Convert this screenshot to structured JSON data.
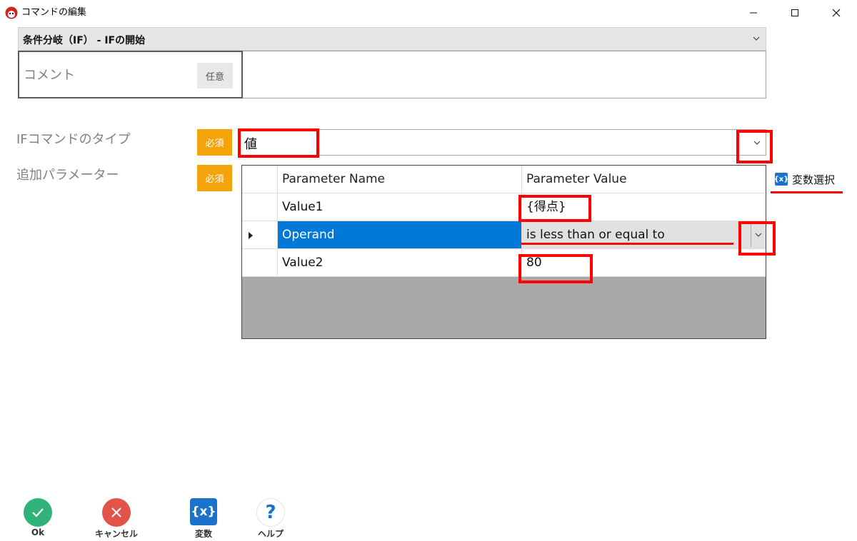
{
  "window": {
    "title": "コマンドの編集"
  },
  "command": {
    "selected": "条件分岐（IF） - IFの開始"
  },
  "comment": {
    "label": "コメント",
    "badge": "任意",
    "value": ""
  },
  "if_type": {
    "label": "IFコマンドのタイプ",
    "badge": "必須",
    "value": "値"
  },
  "params": {
    "label": "追加パラメーター",
    "badge": "必須",
    "columns": [
      "Parameter Name",
      "Parameter Value"
    ],
    "rows": [
      {
        "name": "Value1",
        "value": "{得点}"
      },
      {
        "name": "Operand",
        "value": "is less than or equal to"
      },
      {
        "name": "Value2",
        "value": "80"
      }
    ],
    "selected_row": 1
  },
  "variable_select": {
    "icon": "{x}",
    "label": "変数選択"
  },
  "toolbar": {
    "ok": "Ok",
    "cancel": "キャンセル",
    "variables": "変数",
    "variables_icon": "{x}",
    "help": "ヘルプ",
    "help_icon": "?"
  },
  "colors": {
    "required": "#f4a30b",
    "selection": "#0078d7",
    "annotation": "#ff0000",
    "ok": "#2fb37a",
    "cancel": "#e0544a",
    "variables": "#1a73c9"
  }
}
